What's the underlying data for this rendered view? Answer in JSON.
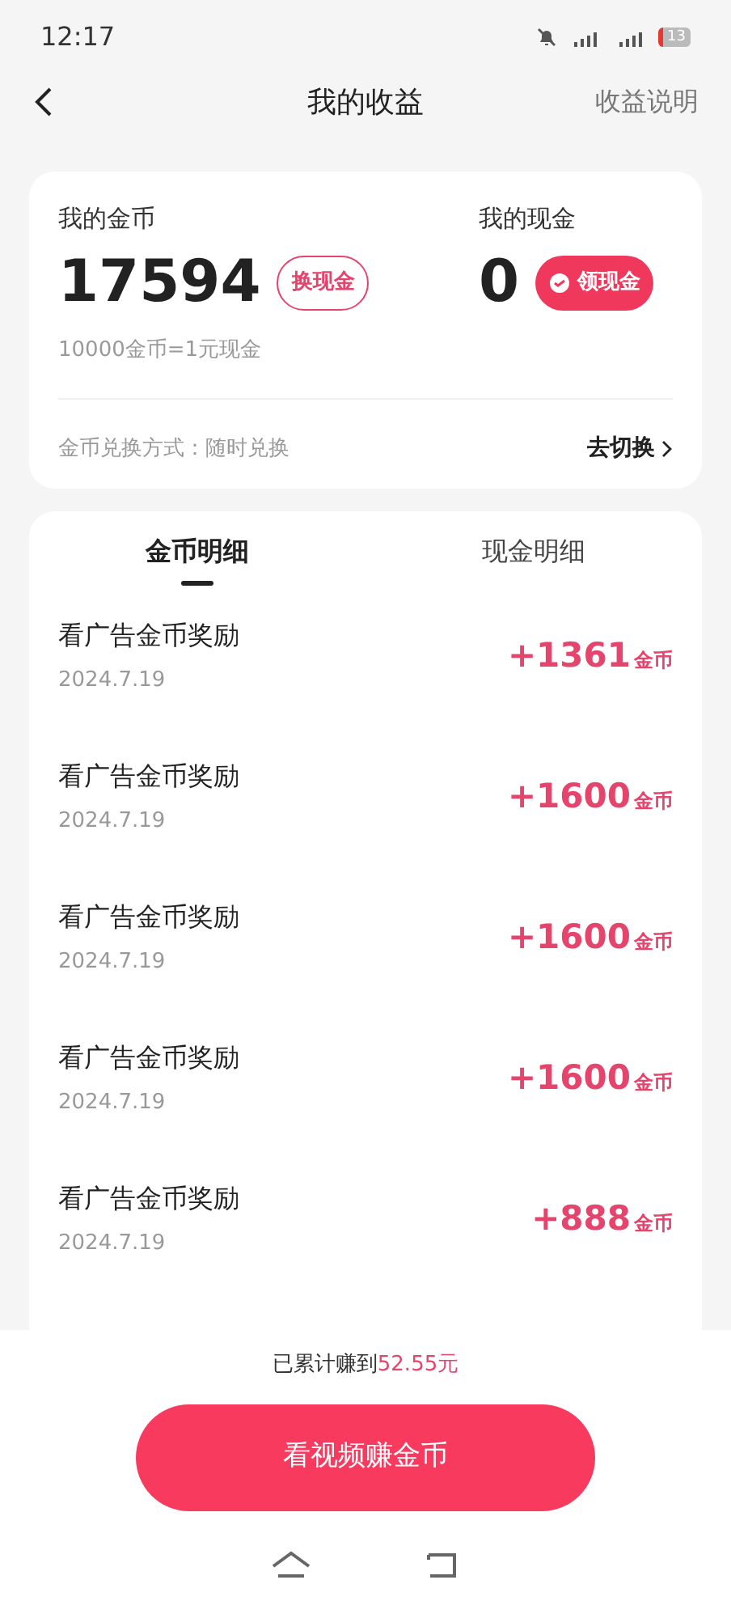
{
  "status_bar": {
    "time": "12:17",
    "battery": "13"
  },
  "header": {
    "title": "我的收益",
    "action": "收益说明"
  },
  "summary": {
    "coins_label": "我的金币",
    "coins": "17594",
    "coins_button": "换现金",
    "cash_label": "我的现金",
    "cash": "0",
    "cash_button": "领现金",
    "rate": "10000金币=1元现金",
    "mode_label": "金币兑换方式：随时兑换",
    "mode_action": "去切换"
  },
  "tabs": [
    {
      "label": "金币明细",
      "selected": true
    },
    {
      "label": "现金明细",
      "selected": false
    }
  ],
  "records": [
    {
      "title": "看广告金币奖励",
      "date": "2024.7.19",
      "amount": "+1361",
      "unit": "金币"
    },
    {
      "title": "看广告金币奖励",
      "date": "2024.7.19",
      "amount": "+1600",
      "unit": "金币"
    },
    {
      "title": "看广告金币奖励",
      "date": "2024.7.19",
      "amount": "+1600",
      "unit": "金币"
    },
    {
      "title": "看广告金币奖励",
      "date": "2024.7.19",
      "amount": "+1600",
      "unit": "金币"
    },
    {
      "title": "看广告金币奖励",
      "date": "2024.7.19",
      "amount": "+888",
      "unit": "金币"
    }
  ],
  "footer": {
    "total_prefix": "已累计赚到",
    "total_value": "52.55元",
    "button": "看视频赚金币"
  }
}
